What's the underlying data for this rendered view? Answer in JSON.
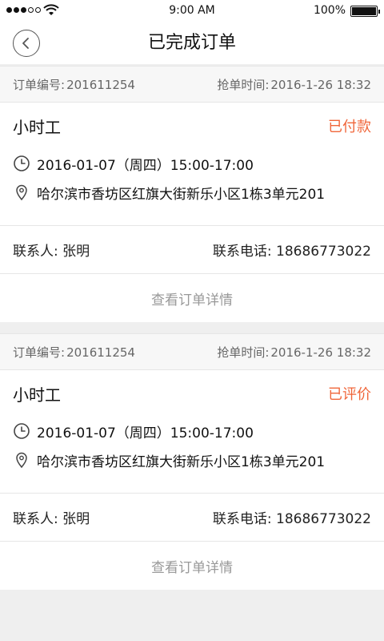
{
  "status_bar": {
    "time": "9:00 AM",
    "battery": "100%"
  },
  "header": {
    "title": "已完成订单"
  },
  "orders": [
    {
      "order_no_label": "订单编号:",
      "order_no": "201611254",
      "grab_time_label": "抢单时间:",
      "grab_time": "2016-1-26 18:32",
      "service": "小时工",
      "status": "已付款",
      "datetime": "2016-01-07（周四）15:00-17:00",
      "address": "哈尔滨市香坊区红旗大街新乐小区1栋3单元201",
      "contact_label": "联系人:",
      "contact_name": "张明",
      "phone_label": "联系电话:",
      "phone": "18686773022",
      "detail_label": "查看订单详情"
    },
    {
      "order_no_label": "订单编号:",
      "order_no": "201611254",
      "grab_time_label": "抢单时间:",
      "grab_time": "2016-1-26 18:32",
      "service": "小时工",
      "status": "已评价",
      "datetime": "2016-01-07（周四）15:00-17:00",
      "address": "哈尔滨市香坊区红旗大街新乐小区1栋3单元201",
      "contact_label": "联系人:",
      "contact_name": "张明",
      "phone_label": "联系电话:",
      "phone": "18686773022",
      "detail_label": "查看订单详情"
    }
  ],
  "colors": {
    "accent": "#f0663a",
    "muted": "#999999",
    "background": "#efefef"
  },
  "icons": {
    "back": "chevron-left-icon",
    "time": "clock-icon",
    "address": "location-pin-icon"
  }
}
